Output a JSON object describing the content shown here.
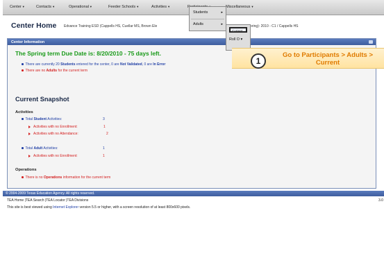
{
  "nav": [
    {
      "label": "Center"
    },
    {
      "label": "Contacts"
    },
    {
      "label": "Operational"
    },
    {
      "label": "Feeder Schools"
    },
    {
      "label": "Activities"
    },
    {
      "label": "Participants"
    },
    {
      "label": "Miscellaneous"
    }
  ],
  "header": {
    "title": "Center Home",
    "subtitle": "Edvance Training ESD (Cappells HS, Cuellar MS, Brown Ele",
    "year_text": "Y Year (Spring): 2010 - C1 / Cappells HS"
  },
  "dropdown": {
    "items": [
      {
        "label": "Students",
        "arrow": "▸"
      },
      {
        "label": "Adults",
        "arrow": "▸"
      }
    ]
  },
  "submenu": {
    "current_label": "Current",
    "roll_label": "Roll O"
  },
  "panel": {
    "title": "Center Information",
    "due_text": "The Spring term Due Date is: 8/20/2010 - 75 days left.",
    "alerts": {
      "students": {
        "p1": "There are currently 20 ",
        "b1": "Students",
        "p2": " entered for the center, 0 are ",
        "b2": "Not Validated",
        "p3": ", 0 are ",
        "b3": "In Error"
      },
      "adults": {
        "p1": "There are no ",
        "b1": "Adults",
        "p2": " for the current term"
      }
    },
    "snapshot_title": "Current Snapshot",
    "activities_heading": "Activities",
    "total_student": {
      "p1": "Total ",
      "b1": "Student",
      "p2": " Activities:",
      "value": "3"
    },
    "no_enrollment_1": {
      "label": "Activities with no Enrollment:",
      "value": "1"
    },
    "no_attendance": {
      "label": "Activities with no Attendance:",
      "value": "2"
    },
    "total_adult": {
      "p1": "Total ",
      "b1": "Adult",
      "p2": " Activities:",
      "value": "1"
    },
    "no_enrollment_2": {
      "label": "Activities with no Enrollment:",
      "value": "1"
    },
    "operations_heading": "Operations",
    "operations_alert": {
      "p1": "There is no ",
      "b1": "Operations",
      "p2": " information for the current term"
    }
  },
  "footer": {
    "copyright": "© 2004-2009 Texas Education Agency. All rights reserved.",
    "links": "TEA Home  |TEA Search  |TEA Locator  |TEA Divisions",
    "version": "3.0",
    "best_viewed_p1": "This site is best viewed using ",
    "best_viewed_link": "Internet Explorer",
    "best_viewed_p2": " version 5.5 or higher, with a screen resolution of at least 800x600 pixels."
  },
  "callout": {
    "step": "1",
    "text": "Go to Participants > Adults > Current"
  },
  "colors": {
    "nav_bar": "#d6d6d6",
    "panel_header": "#4a6aad",
    "due_green": "#1a9a1a",
    "alert_red": "#d42020",
    "link_blue": "#1f3ea5",
    "callout_orange": "#e07b00",
    "callout_bg": "#ffe9b5"
  }
}
